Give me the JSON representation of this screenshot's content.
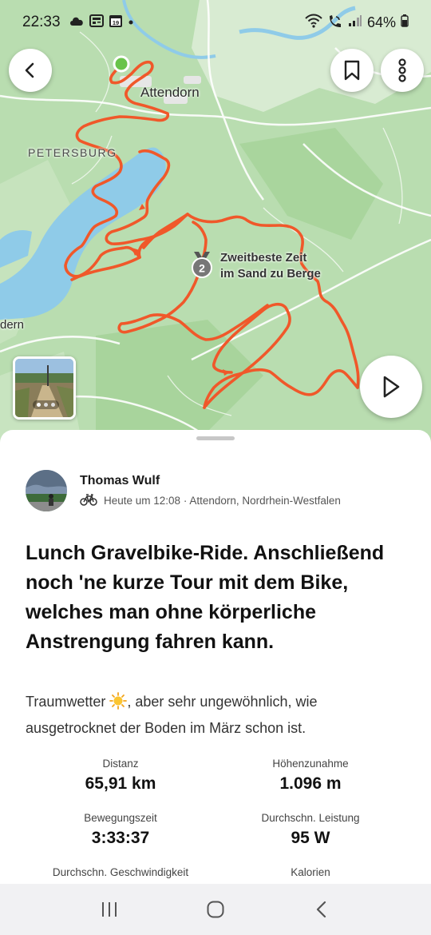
{
  "status_bar": {
    "time": "22:33",
    "calendar_day": "19",
    "battery": "64%"
  },
  "map": {
    "labels": {
      "town": "Attendorn",
      "district": "PETERSBURG",
      "edge_label": "dern",
      "segment_line1": "Zweitbeste Zeit",
      "segment_line2": "im Sand zu Berge",
      "medal_rank": "2"
    },
    "colors": {
      "route": "#f0582a",
      "water": "#8fcbe8",
      "land": "#b8dcae",
      "start_marker": "#69c34a"
    },
    "buttons": [
      "back",
      "bookmark",
      "more",
      "play"
    ]
  },
  "activity": {
    "athlete_name": "Thomas Wulf",
    "meta": "Heute um 12:08 · Attendorn, Nordrhein-Westfalen",
    "title": "Lunch Gravelbike-Ride. Anschließend noch 'ne kurze Tour mit dem Bike, welches man ohne körperliche Anstrengung fahren kann.",
    "description_before": "Traumwetter ",
    "description_after": ", aber sehr ungewöhnlich, wie ausgetrocknet der Boden im März schon ist."
  },
  "stats": [
    {
      "label": "Distanz",
      "value": "65,91 km"
    },
    {
      "label": "Höhenzunahme",
      "value": "1.096 m"
    },
    {
      "label": "Bewegungszeit",
      "value": "3:33:37"
    },
    {
      "label": "Durchschn. Leistung",
      "value": "95 W"
    },
    {
      "label": "Durchschn. Geschwindigkeit",
      "value": ""
    },
    {
      "label": "Kalorien",
      "value": ""
    }
  ]
}
